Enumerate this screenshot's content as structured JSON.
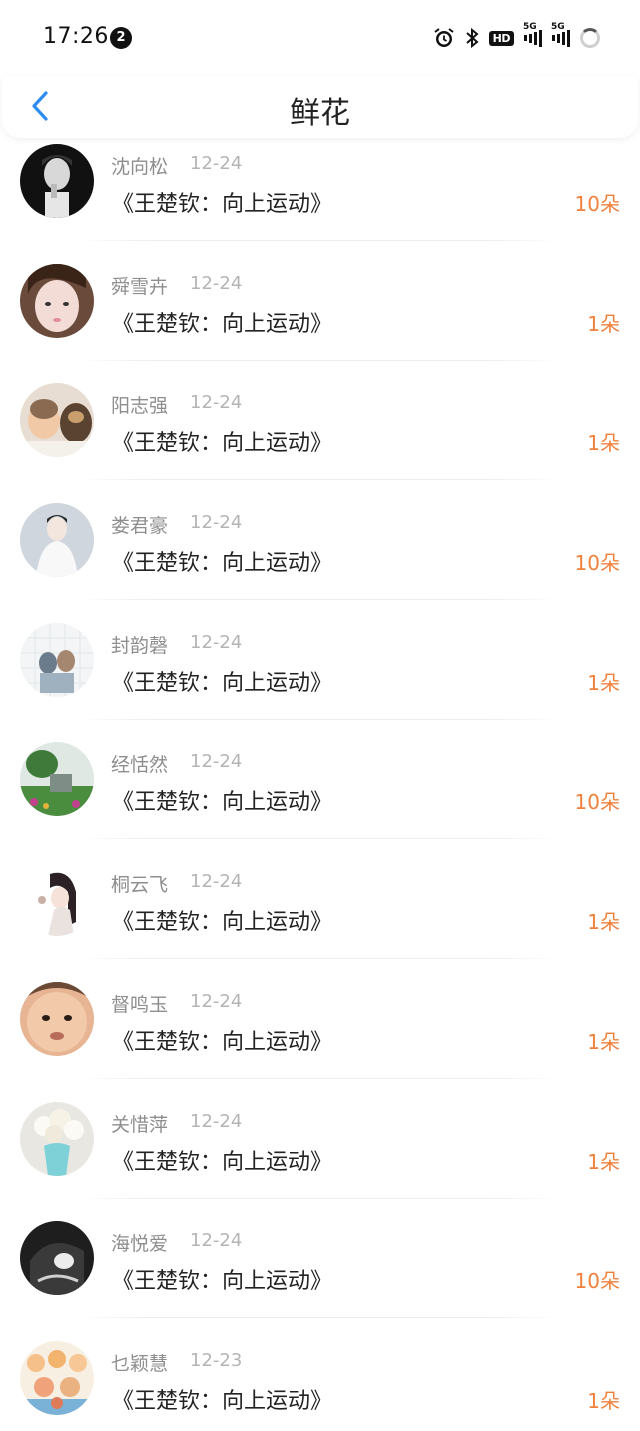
{
  "status_bar": {
    "time": "17:26",
    "notification_count": "2",
    "hd_label": "HD",
    "network_1": "5G",
    "network_2": "5G"
  },
  "header": {
    "title": "鲜花",
    "accent_color": "#2d8cf0"
  },
  "list": [
    {
      "name": "沈向松",
      "date": "12-24",
      "title": "《王楚钦：向上运动》",
      "count": "10朵",
      "avatar": "avatar-man-portrait"
    },
    {
      "name": "舜雪卉",
      "date": "12-24",
      "title": "《王楚钦：向上运动》",
      "count": "1朵",
      "avatar": "avatar-girl-selfie"
    },
    {
      "name": "阳志强",
      "date": "12-24",
      "title": "《王楚钦：向上运动》",
      "count": "1朵",
      "avatar": "avatar-baby-with-dog"
    },
    {
      "name": "娄君豪",
      "date": "12-24",
      "title": "《王楚钦：向上运动》",
      "count": "10朵",
      "avatar": "avatar-white-robed-figure"
    },
    {
      "name": "封韵磬",
      "date": "12-24",
      "title": "《王楚钦：向上运动》",
      "count": "1朵",
      "avatar": "avatar-couple-illustration"
    },
    {
      "name": "经恬然",
      "date": "12-24",
      "title": "《王楚钦：向上运动》",
      "count": "10朵",
      "avatar": "avatar-garden-scene"
    },
    {
      "name": "桐云飞",
      "date": "12-24",
      "title": "《王楚钦：向上运动》",
      "count": "1朵",
      "avatar": "avatar-anime-girl"
    },
    {
      "name": "督鸣玉",
      "date": "12-24",
      "title": "《王楚钦：向上运动》",
      "count": "1朵",
      "avatar": "avatar-baby-face"
    },
    {
      "name": "关惜萍",
      "date": "12-24",
      "title": "《王楚钦：向上运动》",
      "count": "1朵",
      "avatar": "avatar-flower-vase"
    },
    {
      "name": "海悦爱",
      "date": "12-24",
      "title": "《王楚钦：向上运动》",
      "count": "10朵",
      "avatar": "avatar-dark-illustration"
    },
    {
      "name": "乜颖慧",
      "date": "12-23",
      "title": "《王楚钦：向上运动》",
      "count": "1朵",
      "avatar": "avatar-cartoon-group"
    }
  ]
}
